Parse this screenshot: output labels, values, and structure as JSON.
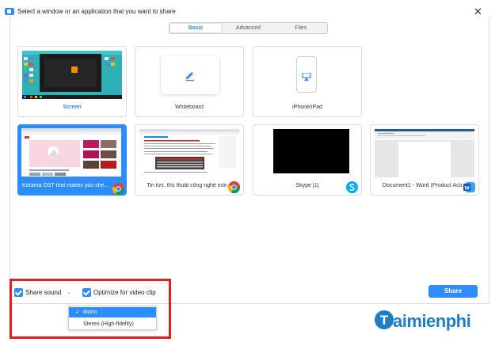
{
  "dialog": {
    "title": "Select a window or an application that you want to share",
    "close_glyph": "✕"
  },
  "tabs": [
    {
      "label": "Basic",
      "active": true
    },
    {
      "label": "Advanced",
      "active": false
    },
    {
      "label": "Files",
      "active": false
    }
  ],
  "tiles": [
    {
      "label": "Screen",
      "icon": "monitor-screen"
    },
    {
      "label": "Whiteboard",
      "icon": "pencil-icon"
    },
    {
      "label": "iPhone/iPad",
      "icon": "airplay-icon"
    },
    {
      "label": "Kdrama OST that makes you she...",
      "icon": "chrome-icon",
      "selected": true
    },
    {
      "label": "Tin tức, thủ thuật công nghệ mới...",
      "icon": "chrome-icon"
    },
    {
      "label": "Skype [1]",
      "icon": "skype-icon"
    },
    {
      "label": "Document1 - Word (Product Acti...",
      "icon": "word-icon"
    }
  ],
  "bottom": {
    "share_sound_label": "Share sound",
    "optimize_label": "Optimize for video clip",
    "share_button": "Share",
    "audio_options": [
      "Mono",
      "Stereo (High-fidelity)"
    ],
    "audio_selected": "Mono"
  },
  "watermark": {
    "text": "aimienphi",
    "letter": "T"
  },
  "colors": {
    "accent": "#2d8cff",
    "highlight_border": "#e2211c",
    "watermark": "#1f7dc6"
  }
}
